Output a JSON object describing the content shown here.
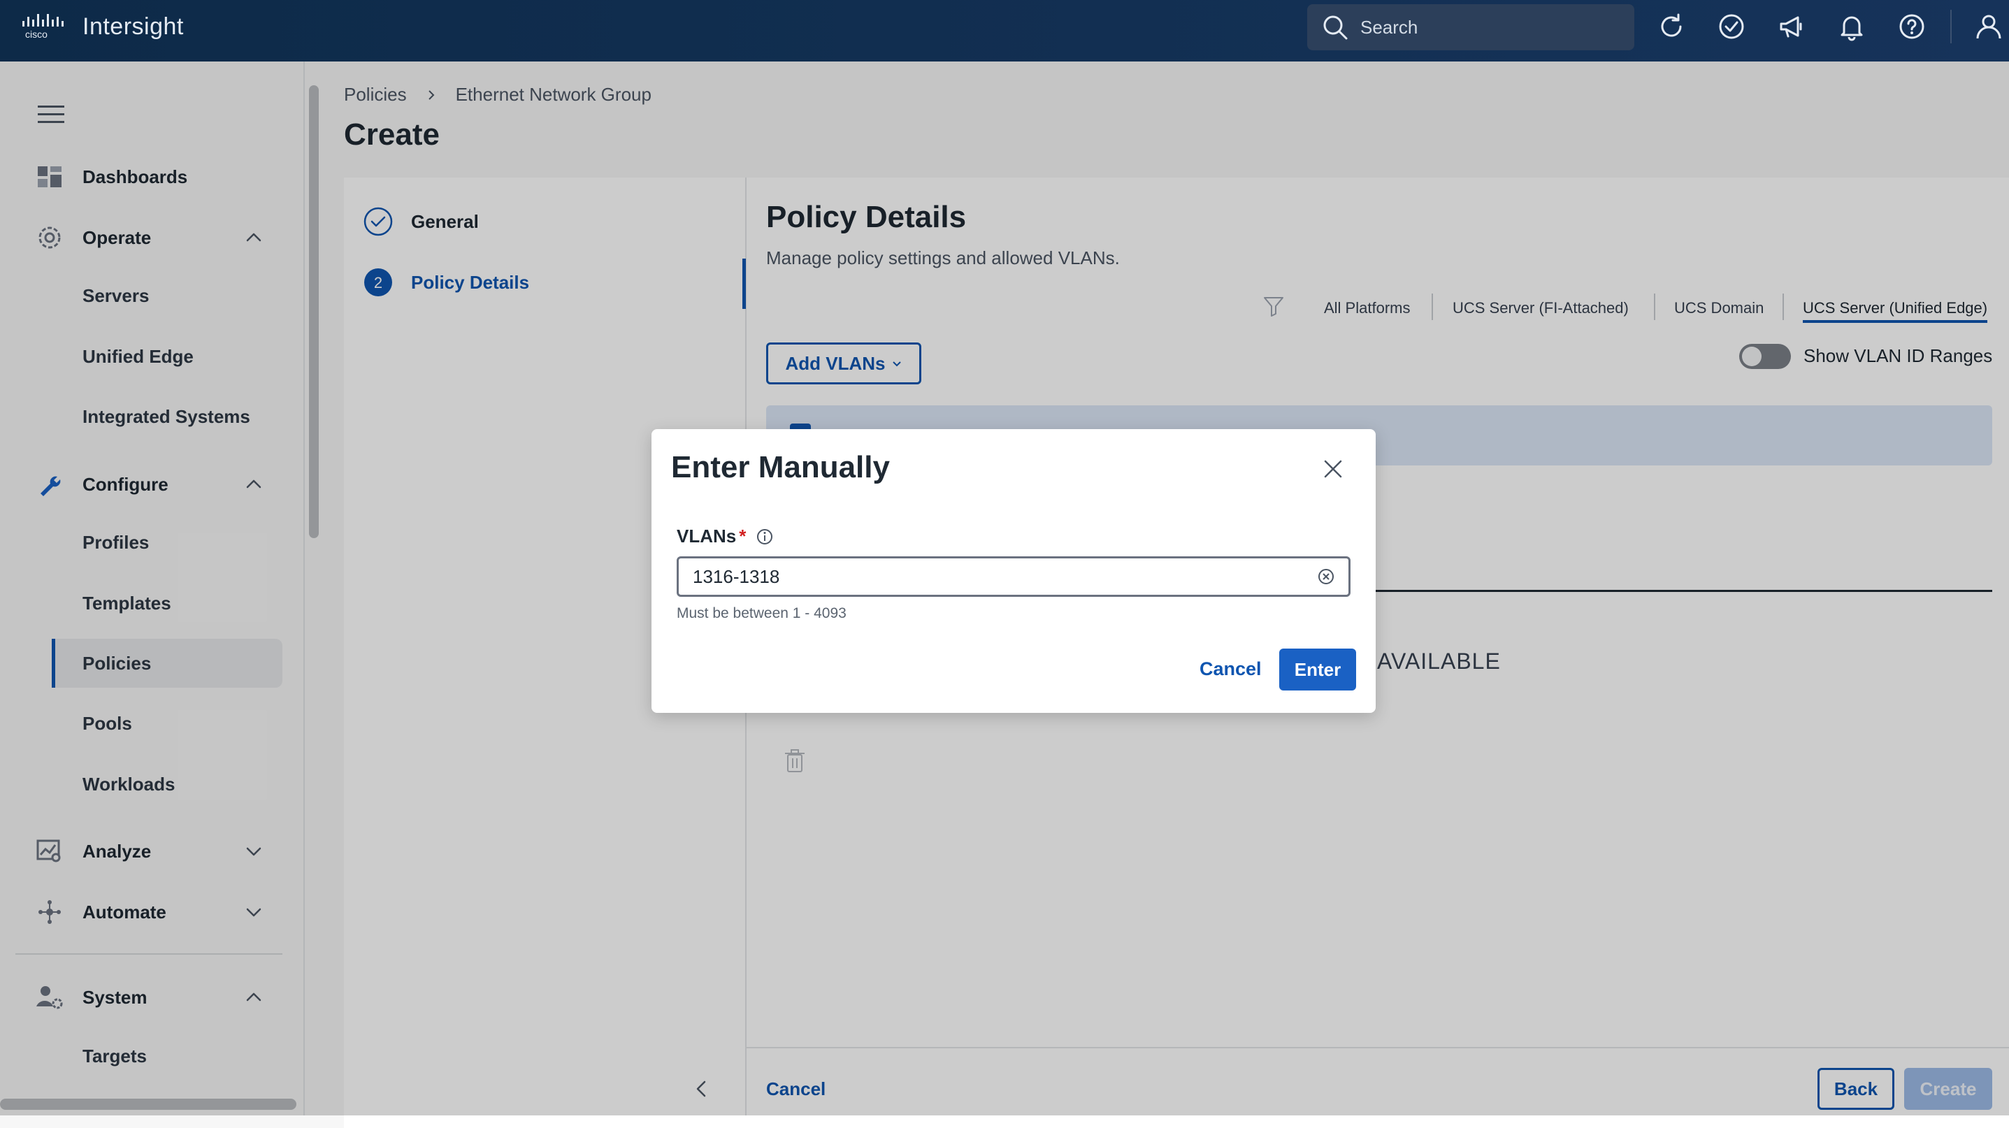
{
  "app": {
    "brand_name": "Intersight"
  },
  "header": {
    "search_placeholder": "Search"
  },
  "sidebar": {
    "dashboards": "Dashboards",
    "operate": "Operate",
    "servers": "Servers",
    "unified_edge": "Unified Edge",
    "integrated_systems": "Integrated Systems",
    "configure": "Configure",
    "profiles": "Profiles",
    "templates": "Templates",
    "policies": "Policies",
    "pools": "Pools",
    "workloads": "Workloads",
    "analyze": "Analyze",
    "automate": "Automate",
    "system": "System",
    "targets": "Targets"
  },
  "breadcrumb": {
    "root": "Policies",
    "current": "Ethernet Network Group"
  },
  "page": {
    "title": "Create"
  },
  "steps": {
    "general": "General",
    "policy_number": "2",
    "policy_details": "Policy Details"
  },
  "details": {
    "title": "Policy Details",
    "subtitle": "Manage policy settings and allowed VLANs.",
    "platform_tabs": [
      "All Platforms",
      "UCS Server (FI-Attached)",
      "UCS Domain",
      "UCS Server (Unified Edge)"
    ],
    "add_vlans": "Add VLANs",
    "show_ranges": "Show VLAN ID Ranges",
    "available_label": "AVAILABLE"
  },
  "footer": {
    "cancel": "Cancel",
    "back": "Back",
    "create": "Create"
  },
  "modal": {
    "title": "Enter Manually",
    "field_label": "VLANs",
    "required_mark": "*",
    "value": "1316-1318",
    "hint": "Must be between 1 - 4093",
    "cancel": "Cancel",
    "enter": "Enter"
  },
  "colors": {
    "accent": "#0f55b0",
    "header": "#0d2a48",
    "required": "#d11f1f"
  }
}
